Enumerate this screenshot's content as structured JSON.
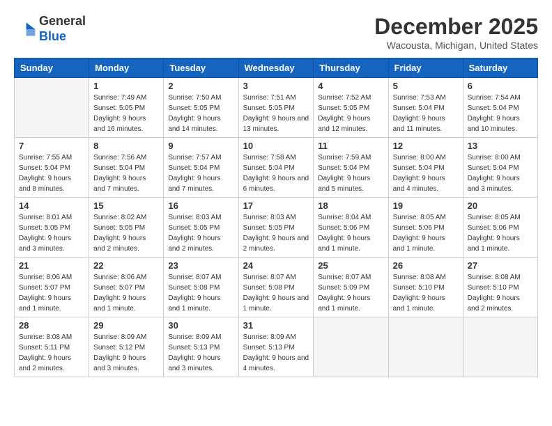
{
  "logo": {
    "general": "General",
    "blue": "Blue"
  },
  "header": {
    "month": "December 2025",
    "location": "Wacousta, Michigan, United States"
  },
  "days_of_week": [
    "Sunday",
    "Monday",
    "Tuesday",
    "Wednesday",
    "Thursday",
    "Friday",
    "Saturday"
  ],
  "weeks": [
    [
      {
        "day": "",
        "sunrise": "",
        "sunset": "",
        "daylight": ""
      },
      {
        "day": "1",
        "sunrise": "Sunrise: 7:49 AM",
        "sunset": "Sunset: 5:05 PM",
        "daylight": "Daylight: 9 hours and 16 minutes."
      },
      {
        "day": "2",
        "sunrise": "Sunrise: 7:50 AM",
        "sunset": "Sunset: 5:05 PM",
        "daylight": "Daylight: 9 hours and 14 minutes."
      },
      {
        "day": "3",
        "sunrise": "Sunrise: 7:51 AM",
        "sunset": "Sunset: 5:05 PM",
        "daylight": "Daylight: 9 hours and 13 minutes."
      },
      {
        "day": "4",
        "sunrise": "Sunrise: 7:52 AM",
        "sunset": "Sunset: 5:05 PM",
        "daylight": "Daylight: 9 hours and 12 minutes."
      },
      {
        "day": "5",
        "sunrise": "Sunrise: 7:53 AM",
        "sunset": "Sunset: 5:04 PM",
        "daylight": "Daylight: 9 hours and 11 minutes."
      },
      {
        "day": "6",
        "sunrise": "Sunrise: 7:54 AM",
        "sunset": "Sunset: 5:04 PM",
        "daylight": "Daylight: 9 hours and 10 minutes."
      }
    ],
    [
      {
        "day": "7",
        "sunrise": "Sunrise: 7:55 AM",
        "sunset": "Sunset: 5:04 PM",
        "daylight": "Daylight: 9 hours and 8 minutes."
      },
      {
        "day": "8",
        "sunrise": "Sunrise: 7:56 AM",
        "sunset": "Sunset: 5:04 PM",
        "daylight": "Daylight: 9 hours and 7 minutes."
      },
      {
        "day": "9",
        "sunrise": "Sunrise: 7:57 AM",
        "sunset": "Sunset: 5:04 PM",
        "daylight": "Daylight: 9 hours and 7 minutes."
      },
      {
        "day": "10",
        "sunrise": "Sunrise: 7:58 AM",
        "sunset": "Sunset: 5:04 PM",
        "daylight": "Daylight: 9 hours and 6 minutes."
      },
      {
        "day": "11",
        "sunrise": "Sunrise: 7:59 AM",
        "sunset": "Sunset: 5:04 PM",
        "daylight": "Daylight: 9 hours and 5 minutes."
      },
      {
        "day": "12",
        "sunrise": "Sunrise: 8:00 AM",
        "sunset": "Sunset: 5:04 PM",
        "daylight": "Daylight: 9 hours and 4 minutes."
      },
      {
        "day": "13",
        "sunrise": "Sunrise: 8:00 AM",
        "sunset": "Sunset: 5:04 PM",
        "daylight": "Daylight: 9 hours and 3 minutes."
      }
    ],
    [
      {
        "day": "14",
        "sunrise": "Sunrise: 8:01 AM",
        "sunset": "Sunset: 5:05 PM",
        "daylight": "Daylight: 9 hours and 3 minutes."
      },
      {
        "day": "15",
        "sunrise": "Sunrise: 8:02 AM",
        "sunset": "Sunset: 5:05 PM",
        "daylight": "Daylight: 9 hours and 2 minutes."
      },
      {
        "day": "16",
        "sunrise": "Sunrise: 8:03 AM",
        "sunset": "Sunset: 5:05 PM",
        "daylight": "Daylight: 9 hours and 2 minutes."
      },
      {
        "day": "17",
        "sunrise": "Sunrise: 8:03 AM",
        "sunset": "Sunset: 5:05 PM",
        "daylight": "Daylight: 9 hours and 2 minutes."
      },
      {
        "day": "18",
        "sunrise": "Sunrise: 8:04 AM",
        "sunset": "Sunset: 5:06 PM",
        "daylight": "Daylight: 9 hours and 1 minute."
      },
      {
        "day": "19",
        "sunrise": "Sunrise: 8:05 AM",
        "sunset": "Sunset: 5:06 PM",
        "daylight": "Daylight: 9 hours and 1 minute."
      },
      {
        "day": "20",
        "sunrise": "Sunrise: 8:05 AM",
        "sunset": "Sunset: 5:06 PM",
        "daylight": "Daylight: 9 hours and 1 minute."
      }
    ],
    [
      {
        "day": "21",
        "sunrise": "Sunrise: 8:06 AM",
        "sunset": "Sunset: 5:07 PM",
        "daylight": "Daylight: 9 hours and 1 minute."
      },
      {
        "day": "22",
        "sunrise": "Sunrise: 8:06 AM",
        "sunset": "Sunset: 5:07 PM",
        "daylight": "Daylight: 9 hours and 1 minute."
      },
      {
        "day": "23",
        "sunrise": "Sunrise: 8:07 AM",
        "sunset": "Sunset: 5:08 PM",
        "daylight": "Daylight: 9 hours and 1 minute."
      },
      {
        "day": "24",
        "sunrise": "Sunrise: 8:07 AM",
        "sunset": "Sunset: 5:08 PM",
        "daylight": "Daylight: 9 hours and 1 minute."
      },
      {
        "day": "25",
        "sunrise": "Sunrise: 8:07 AM",
        "sunset": "Sunset: 5:09 PM",
        "daylight": "Daylight: 9 hours and 1 minute."
      },
      {
        "day": "26",
        "sunrise": "Sunrise: 8:08 AM",
        "sunset": "Sunset: 5:10 PM",
        "daylight": "Daylight: 9 hours and 1 minute."
      },
      {
        "day": "27",
        "sunrise": "Sunrise: 8:08 AM",
        "sunset": "Sunset: 5:10 PM",
        "daylight": "Daylight: 9 hours and 2 minutes."
      }
    ],
    [
      {
        "day": "28",
        "sunrise": "Sunrise: 8:08 AM",
        "sunset": "Sunset: 5:11 PM",
        "daylight": "Daylight: 9 hours and 2 minutes."
      },
      {
        "day": "29",
        "sunrise": "Sunrise: 8:09 AM",
        "sunset": "Sunset: 5:12 PM",
        "daylight": "Daylight: 9 hours and 3 minutes."
      },
      {
        "day": "30",
        "sunrise": "Sunrise: 8:09 AM",
        "sunset": "Sunset: 5:13 PM",
        "daylight": "Daylight: 9 hours and 3 minutes."
      },
      {
        "day": "31",
        "sunrise": "Sunrise: 8:09 AM",
        "sunset": "Sunset: 5:13 PM",
        "daylight": "Daylight: 9 hours and 4 minutes."
      },
      {
        "day": "",
        "sunrise": "",
        "sunset": "",
        "daylight": ""
      },
      {
        "day": "",
        "sunrise": "",
        "sunset": "",
        "daylight": ""
      },
      {
        "day": "",
        "sunrise": "",
        "sunset": "",
        "daylight": ""
      }
    ]
  ]
}
